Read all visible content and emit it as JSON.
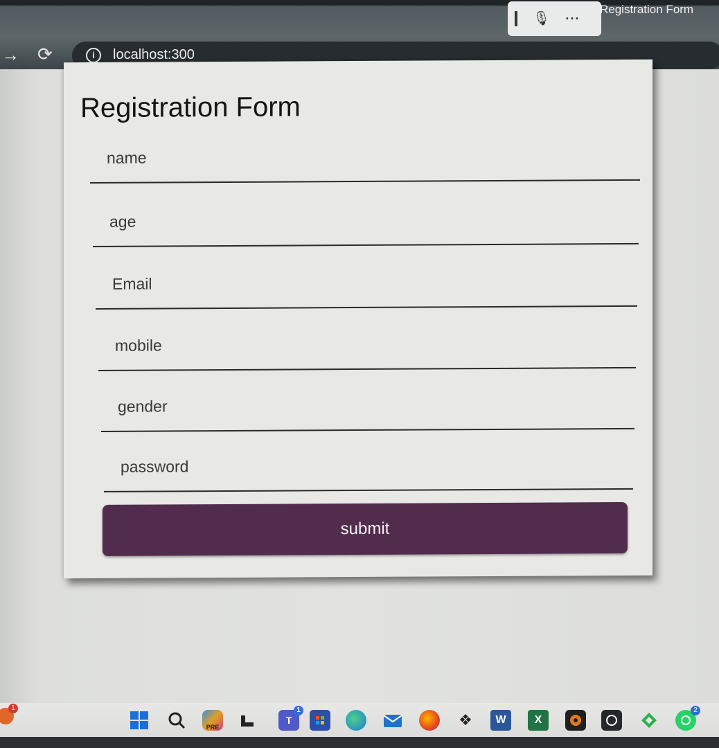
{
  "browser": {
    "tab_title": "Registration Form",
    "url": "localhost:300",
    "voice_toolbar": {
      "more_label": "···"
    }
  },
  "form": {
    "title": "Registration Form",
    "fields": [
      {
        "placeholder": "name"
      },
      {
        "placeholder": "age"
      },
      {
        "placeholder": "Email"
      },
      {
        "placeholder": "mobile"
      },
      {
        "placeholder": "gender"
      },
      {
        "placeholder": "password"
      }
    ],
    "submit_label": "submit",
    "submit_color": "#522c4d"
  },
  "taskbar": {
    "items": [
      {
        "name": "start",
        "icon": "windows-icon"
      },
      {
        "name": "search",
        "icon": "search-icon"
      },
      {
        "name": "copilot",
        "icon": "copilot-icon",
        "label": "PRE"
      },
      {
        "name": "taskview",
        "icon": "taskview-icon"
      },
      {
        "name": "teams",
        "icon": "teams-icon",
        "label": "T",
        "badge": "1"
      },
      {
        "name": "store",
        "icon": "store-icon"
      },
      {
        "name": "edge",
        "icon": "edge-icon"
      },
      {
        "name": "mail",
        "icon": "mail-icon"
      },
      {
        "name": "firefox",
        "icon": "firefox-icon"
      },
      {
        "name": "dropbox",
        "icon": "dropbox-icon"
      },
      {
        "name": "word",
        "icon": "word-icon",
        "label": "W"
      },
      {
        "name": "excel",
        "icon": "excel-icon",
        "label": "X"
      },
      {
        "name": "obs",
        "icon": "obs-icon"
      },
      {
        "name": "github",
        "icon": "github-icon"
      },
      {
        "name": "feedly",
        "icon": "feedly-icon"
      },
      {
        "name": "whatsapp",
        "icon": "whatsapp-icon",
        "badge": "2"
      }
    ],
    "notification_badge": "1"
  }
}
